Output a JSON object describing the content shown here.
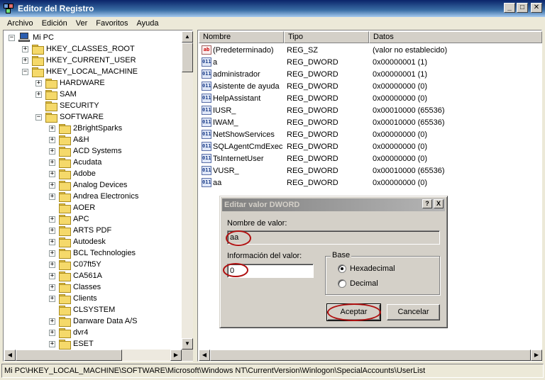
{
  "window": {
    "title": "Editor del Registro"
  },
  "menu": [
    "Archivo",
    "Edición",
    "Ver",
    "Favoritos",
    "Ayuda"
  ],
  "tree": [
    {
      "label": "Mi PC",
      "level": 0,
      "exp": "-",
      "icon": "pc"
    },
    {
      "label": "HKEY_CLASSES_ROOT",
      "level": 1,
      "exp": "+",
      "icon": "folder"
    },
    {
      "label": "HKEY_CURRENT_USER",
      "level": 1,
      "exp": "+",
      "icon": "folder"
    },
    {
      "label": "HKEY_LOCAL_MACHINE",
      "level": 1,
      "exp": "-",
      "icon": "folder"
    },
    {
      "label": "HARDWARE",
      "level": 2,
      "exp": "+",
      "icon": "folder"
    },
    {
      "label": "SAM",
      "level": 2,
      "exp": "+",
      "icon": "folder"
    },
    {
      "label": "SECURITY",
      "level": 2,
      "exp": "",
      "icon": "folder"
    },
    {
      "label": "SOFTWARE",
      "level": 2,
      "exp": "-",
      "icon": "folder"
    },
    {
      "label": "2BrightSparks",
      "level": 3,
      "exp": "+",
      "icon": "folder"
    },
    {
      "label": "A&H",
      "level": 3,
      "exp": "+",
      "icon": "folder"
    },
    {
      "label": "ACD Systems",
      "level": 3,
      "exp": "+",
      "icon": "folder"
    },
    {
      "label": "Acudata",
      "level": 3,
      "exp": "+",
      "icon": "folder"
    },
    {
      "label": "Adobe",
      "level": 3,
      "exp": "+",
      "icon": "folder"
    },
    {
      "label": "Analog Devices",
      "level": 3,
      "exp": "+",
      "icon": "folder"
    },
    {
      "label": "Andrea Electronics",
      "level": 3,
      "exp": "+",
      "icon": "folder"
    },
    {
      "label": "AOER",
      "level": 3,
      "exp": "",
      "icon": "folder"
    },
    {
      "label": "APC",
      "level": 3,
      "exp": "+",
      "icon": "folder"
    },
    {
      "label": "ARTS PDF",
      "level": 3,
      "exp": "+",
      "icon": "folder"
    },
    {
      "label": "Autodesk",
      "level": 3,
      "exp": "+",
      "icon": "folder"
    },
    {
      "label": "BCL Technologies",
      "level": 3,
      "exp": "+",
      "icon": "folder"
    },
    {
      "label": "C07ft5Y",
      "level": 3,
      "exp": "+",
      "icon": "folder"
    },
    {
      "label": "CA561A",
      "level": 3,
      "exp": "+",
      "icon": "folder"
    },
    {
      "label": "Classes",
      "level": 3,
      "exp": "+",
      "icon": "folder"
    },
    {
      "label": "Clients",
      "level": 3,
      "exp": "+",
      "icon": "folder"
    },
    {
      "label": "CLSYSTEM",
      "level": 3,
      "exp": "",
      "icon": "folder"
    },
    {
      "label": "Danware Data A/S",
      "level": 3,
      "exp": "+",
      "icon": "folder"
    },
    {
      "label": "dvr4",
      "level": 3,
      "exp": "+",
      "icon": "folder"
    },
    {
      "label": "ESET",
      "level": 3,
      "exp": "+",
      "icon": "folder"
    }
  ],
  "list": {
    "headers": {
      "name": "Nombre",
      "type": "Tipo",
      "data": "Datos"
    },
    "rows": [
      {
        "name": "(Predeterminado)",
        "type": "REG_SZ",
        "data": "(valor no establecido)",
        "icon": "ab"
      },
      {
        "name": "a",
        "type": "REG_DWORD",
        "data": "0x00000001 (1)",
        "icon": "dw"
      },
      {
        "name": "administrador",
        "type": "REG_DWORD",
        "data": "0x00000001 (1)",
        "icon": "dw"
      },
      {
        "name": "Asistente de ayuda",
        "type": "REG_DWORD",
        "data": "0x00000000 (0)",
        "icon": "dw"
      },
      {
        "name": "HelpAssistant",
        "type": "REG_DWORD",
        "data": "0x00000000 (0)",
        "icon": "dw"
      },
      {
        "name": "IUSR_",
        "type": "REG_DWORD",
        "data": "0x00010000 (65536)",
        "icon": "dw"
      },
      {
        "name": "IWAM_",
        "type": "REG_DWORD",
        "data": "0x00010000 (65536)",
        "icon": "dw"
      },
      {
        "name": "NetShowServices",
        "type": "REG_DWORD",
        "data": "0x00000000 (0)",
        "icon": "dw"
      },
      {
        "name": "SQLAgentCmdExec",
        "type": "REG_DWORD",
        "data": "0x00000000 (0)",
        "icon": "dw"
      },
      {
        "name": "TsInternetUser",
        "type": "REG_DWORD",
        "data": "0x00000000 (0)",
        "icon": "dw"
      },
      {
        "name": "VUSR_",
        "type": "REG_DWORD",
        "data": "0x00010000 (65536)",
        "icon": "dw"
      },
      {
        "name": "aa",
        "type": "REG_DWORD",
        "data": "0x00000000 (0)",
        "icon": "dw"
      }
    ]
  },
  "dialog": {
    "title": "Editar valor DWORD",
    "help_btn": "?",
    "close_btn": "X",
    "name_label": "Nombre de valor:",
    "name_value": "aa",
    "info_label": "Información del valor:",
    "info_value": "0",
    "base_label": "Base",
    "hex_label": "Hexadecimal",
    "dec_label": "Decimal",
    "ok": "Aceptar",
    "cancel": "Cancelar"
  },
  "status": "Mi PC\\HKEY_LOCAL_MACHINE\\SOFTWARE\\Microsoft\\Windows NT\\CurrentVersion\\Winlogon\\SpecialAccounts\\UserList",
  "icons": {
    "tree_folder": "folder-icon",
    "tree_root": "computer-icon",
    "value_string": "string-value-icon",
    "value_dword": "binary-value-icon"
  },
  "icon_text": {
    "ab": "ab",
    "dw": "011"
  },
  "colors": {
    "annotation": "#b01010"
  }
}
